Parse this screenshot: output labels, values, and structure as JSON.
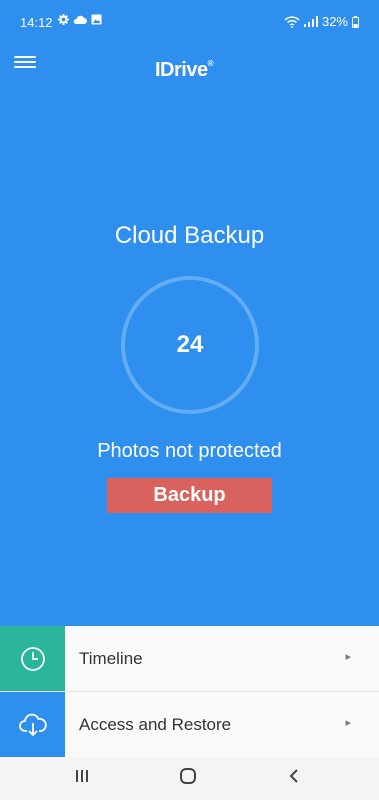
{
  "status_bar": {
    "time": "14:12",
    "battery": "32%",
    "icons_left": [
      "gear-icon",
      "cloud-icon",
      "image-icon"
    ],
    "icons_right": [
      "wifi-icon",
      "signal-icon",
      "battery-icon"
    ]
  },
  "app_bar": {
    "logo_text": "IDrive",
    "logo_mark": "®",
    "menu_icon": "hamburger-menu-icon"
  },
  "main": {
    "title": "Cloud Backup",
    "count": "24",
    "status_text": "Photos not protected",
    "backup_button": "Backup"
  },
  "list": [
    {
      "label": "Timeline",
      "icon": "clock-icon",
      "color": "#2bb59a"
    },
    {
      "label": "Access and Restore",
      "icon": "cloud-download-icon",
      "color": "#2f8fee"
    }
  ],
  "nav_bar": {
    "icons": [
      "recent-apps-icon",
      "home-icon",
      "back-icon"
    ]
  }
}
